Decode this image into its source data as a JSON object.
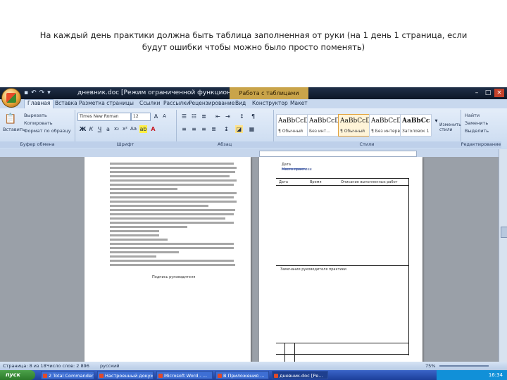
{
  "caption": {
    "line1": "На каждый день практики должна быть таблица заполненная от руки (на 1 день 1 страница, если",
    "line2": "будут ошибки чтобы можно было просто поменять)"
  },
  "window": {
    "title": "дневник.doc [Режим ограниченной функциональности] - Mi...",
    "context_tab": "Работа с таблицами"
  },
  "tabs": [
    "Главная",
    "Вставка",
    "Разметка страницы",
    "Ссылки",
    "Рассылки",
    "Рецензирование",
    "Вид",
    "Конструктор",
    "Макет"
  ],
  "ribbon": {
    "clipboard": {
      "paste": "Вставить",
      "cut": "Вырезать",
      "copy": "Копировать",
      "format": "Формат по образцу",
      "label": "Буфер обмена"
    },
    "font": {
      "name": "Times New Roman",
      "size": "12",
      "label": "Шрифт"
    },
    "paragraph": {
      "label": "Абзац"
    },
    "styles": {
      "label": "Стили",
      "items": [
        {
          "sample": "AaBbCcDc",
          "name": "¶ Обычный"
        },
        {
          "sample": "AaBbCcDc",
          "name": "Без инт..."
        },
        {
          "sample": "AaBbCcDc",
          "name": "¶ Обычный"
        },
        {
          "sample": "AaBbCcDc",
          "name": "¶ Без интерв..."
        },
        {
          "sample": "AaBbCc",
          "name": "Заголовок 1"
        }
      ],
      "change": "Изменить стили"
    },
    "editing": {
      "find": "Найти",
      "replace": "Заменить",
      "select": "Выделить",
      "label": "Редактирование"
    }
  },
  "status": {
    "page": "Страница: 8 из 18",
    "words": "Число слов: 2 896",
    "lang": "русский",
    "zoom": "75%"
  },
  "taskbar": {
    "start": "пуск",
    "tasks": [
      "2 Total Commander",
      "Настроенный докум...",
      "Microsoft Word - ...",
      "В Приложения ...",
      "дневник.doc [Ре..."
    ],
    "clock": "16:34"
  },
  "doc": {
    "left_footer": "Подпись руководителя",
    "right_header1": "Дата",
    "right_header2": "Место практики",
    "col1": "Дата",
    "col2": "Время",
    "col3": "Описание выполненных работ",
    "note": "Замечания руководителя практики"
  }
}
